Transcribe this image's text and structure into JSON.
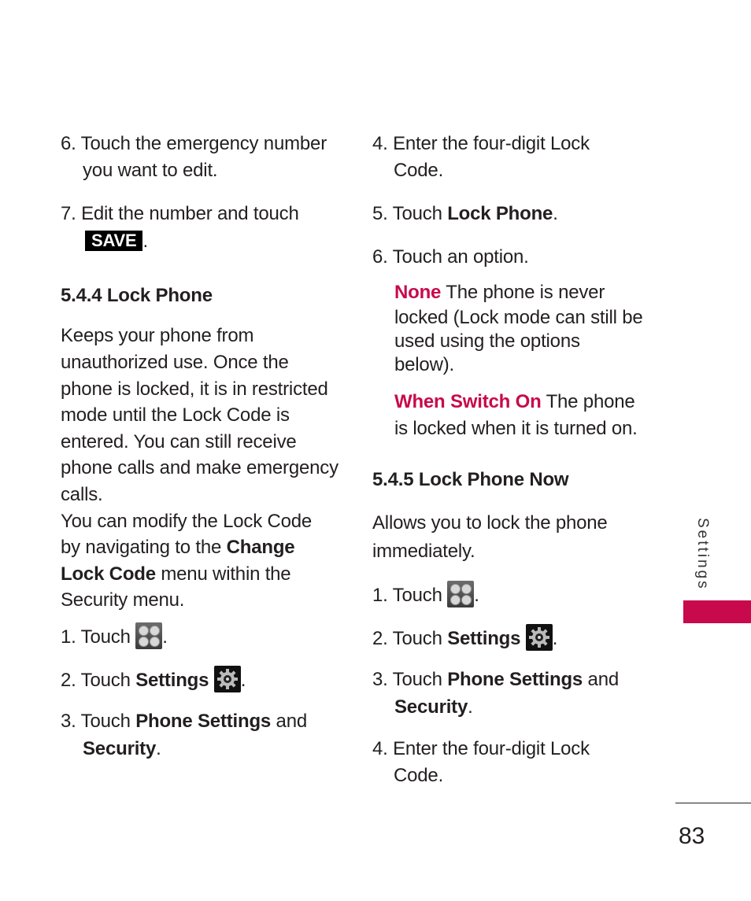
{
  "left": {
    "step6": {
      "num": "6.",
      "line1": "Touch the emergency number",
      "line2": "you want to edit."
    },
    "step7": {
      "num": "7.",
      "line1": "Edit the number and touch",
      "save_button": "SAVE",
      "end": "."
    },
    "section_heading": "5.4.4 Lock Phone",
    "intro_lines": [
      "Keeps your phone from",
      "unauthorized use. Once the",
      "phone is locked, it is in restricted",
      "mode until the Lock Code is",
      "entered. You can still receive",
      "phone calls and make emergency",
      "calls."
    ],
    "modify": {
      "line1": "You can modify the Lock Code",
      "line2_pre": "by navigating to the ",
      "line2_bold": "Change",
      "line3_bold": "Lock Code",
      "line3_post": " menu within the",
      "line4": "Security menu."
    },
    "steps": [
      {
        "num": "1.",
        "text": "Touch ",
        "icon": "menu-grid-icon",
        "end": "."
      },
      {
        "num": "2.",
        "text": "Touch ",
        "bold": "Settings",
        "icon": "settings-gear-icon",
        "end": "."
      },
      {
        "num": "3.",
        "text": "Touch ",
        "bold": "Phone Settings",
        "post": " and",
        "line2_bold": "Security",
        "line2_end": "."
      }
    ]
  },
  "right": {
    "step4": {
      "num": "4.",
      "line1": "Enter the four-digit Lock",
      "line2": "Code."
    },
    "step5": {
      "num": "5.",
      "text": "Touch ",
      "bold": "Lock Phone",
      "end": "."
    },
    "step6": {
      "num": "6.",
      "text": "Touch an option."
    },
    "options": [
      {
        "name": "None",
        "lines": [
          "The phone is never",
          "locked (Lock mode can still be",
          "used using the options",
          "below)."
        ]
      },
      {
        "name": "When Switch On",
        "lines": [
          "The phone",
          "is locked when it is turned on."
        ]
      }
    ],
    "section_heading": "5.4.5 Lock Phone Now",
    "intro_lines": [
      "Allows you to lock the phone",
      "immediately."
    ],
    "steps": [
      {
        "num": "1.",
        "text": "Touch ",
        "icon": "menu-grid-icon",
        "end": "."
      },
      {
        "num": "2.",
        "text": "Touch ",
        "bold": "Settings",
        "icon": "settings-gear-icon",
        "end": "."
      },
      {
        "num": "3.",
        "text": "Touch ",
        "bold": "Phone Settings",
        "post": " and",
        "line2_bold": "Security",
        "line2_end": "."
      },
      {
        "num": "4.",
        "line1": "Enter the four-digit Lock",
        "line2": "Code."
      }
    ]
  },
  "side_tab": {
    "label": "Settings",
    "color": "#c8094c"
  },
  "page_number": "83",
  "accent_color": "#c8094c"
}
